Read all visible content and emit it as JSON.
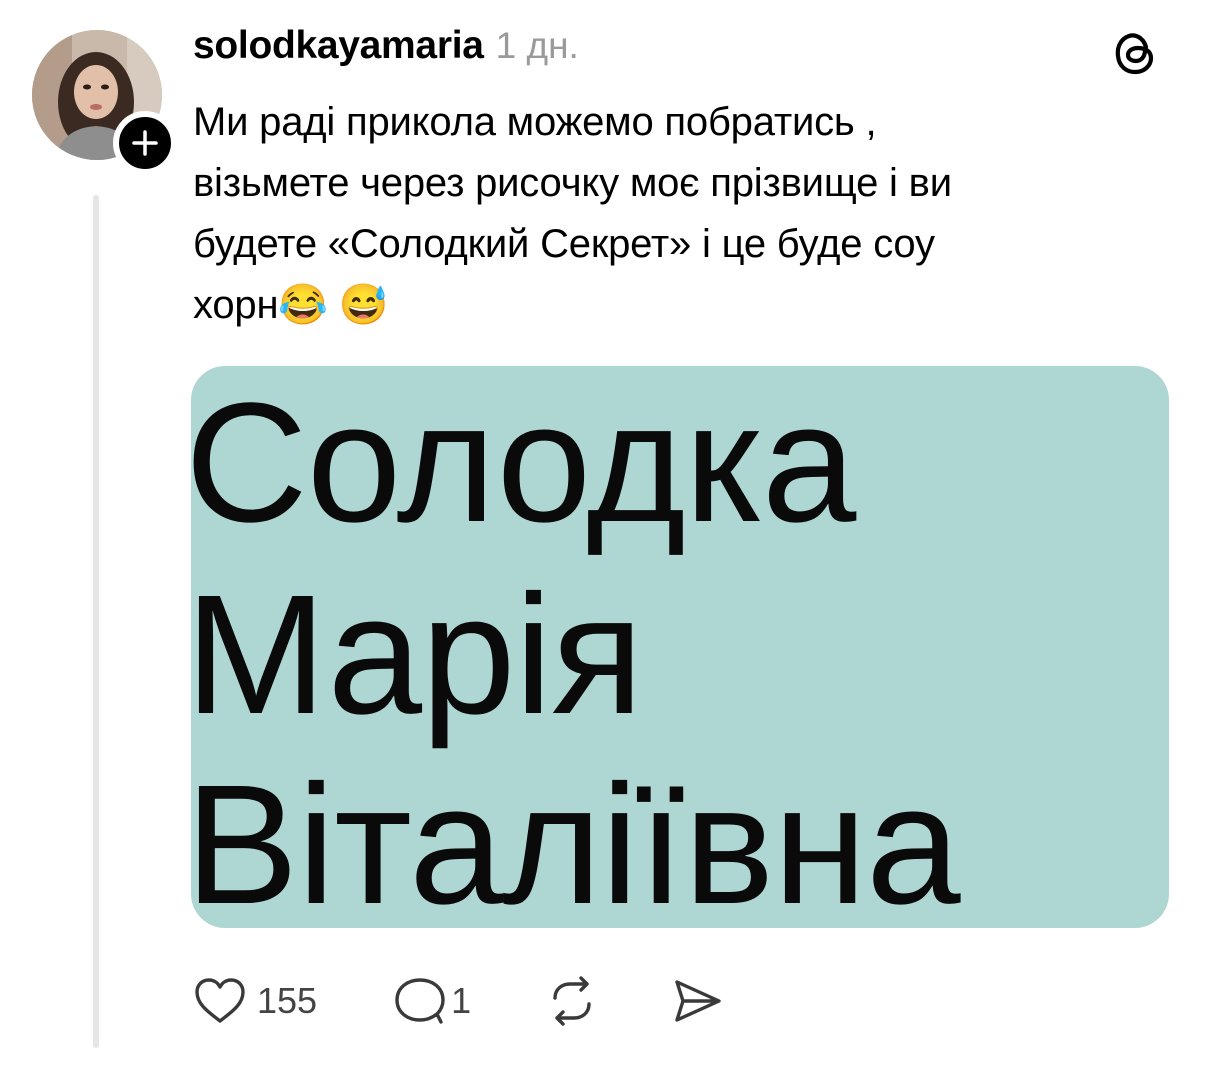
{
  "post": {
    "username": "solodkayamaria",
    "time": "1 дн.",
    "text_lines": [
      "Ми раді прикола можемо побратись ,",
      "візьмете через рисочку моє прізвище і ви",
      "будете «Солодкий Секрет» і це буде соу",
      "хорн😂 😅"
    ],
    "media_text": [
      "Солодка",
      "Марія",
      "Віталіївна"
    ],
    "likes": "155",
    "replies": "1"
  },
  "colors": {
    "media_background": "#aed6d3",
    "thread_line": "#e6e6e6",
    "muted_text": "#9a9a9a"
  },
  "icons": [
    "follow-plus-icon",
    "threads-logo-icon",
    "heart-icon",
    "reply-icon",
    "repost-icon",
    "share-icon"
  ]
}
